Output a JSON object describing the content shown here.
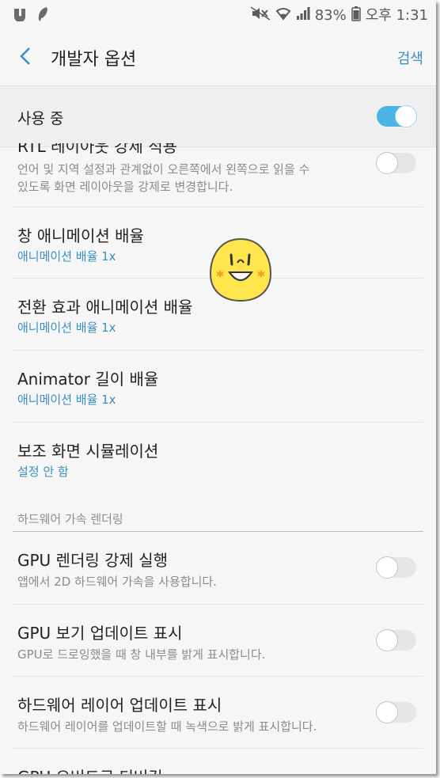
{
  "status_bar": {
    "battery_percent": "83%",
    "time": "오후 1:31",
    "left_icons": [
      "app-icon",
      "feather-icon"
    ],
    "right_icons": [
      "mute-icon",
      "wifi-icon",
      "signal-icon",
      "battery-icon"
    ]
  },
  "app_bar": {
    "title": "개발자 옵션",
    "search_label": "검색",
    "back_icon": "chevron-left-icon"
  },
  "master_switch": {
    "label": "사용 중",
    "enabled": true
  },
  "items": [
    {
      "title": "RTL 레이아웃 강제 적용",
      "subtitle_lines": [
        "언어 및 지역 설정과 관계없이 오른쪽에서 왼쪽으로 읽을 수",
        "있도록 화면 레이아웃을 강제로 변경합니다."
      ],
      "toggle": false
    },
    {
      "title": "창 애니메이션 배율",
      "subtitle": "애니메이션 배율 1x"
    },
    {
      "title": "전환 효과 애니메이션 배율",
      "subtitle": "애니메이션 배율 1x"
    },
    {
      "title": "Animator 길이 배율",
      "subtitle": "애니메이션 배율 1x"
    },
    {
      "title": "보조 화면 시뮬레이션",
      "subtitle": "설정 안 함"
    }
  ],
  "section": {
    "header": "하드웨어 가속 렌더링",
    "items": [
      {
        "title": "GPU 렌더링 강제 실행",
        "subtitle": "앱에서 2D 하드웨어 가속을 사용합니다.",
        "toggle": false
      },
      {
        "title": "GPU 보기 업데이트 표시",
        "subtitle": "GPU로 드로잉했을 때 창 내부를 밝게 표시합니다.",
        "toggle": false
      },
      {
        "title": "하드웨어 레이어 업데이트 표시",
        "subtitle": "하드웨어 레이어를 업데이트할 때 녹색으로 밝게 표시합니다.",
        "toggle": false
      },
      {
        "title": "GPU 오버드로 디버깅"
      }
    ]
  },
  "colors": {
    "accent": "#3b8fc1",
    "toggle_on": "#4bb4e3",
    "background": "#f6f6f6",
    "emoji_face": "#ffe64d"
  }
}
